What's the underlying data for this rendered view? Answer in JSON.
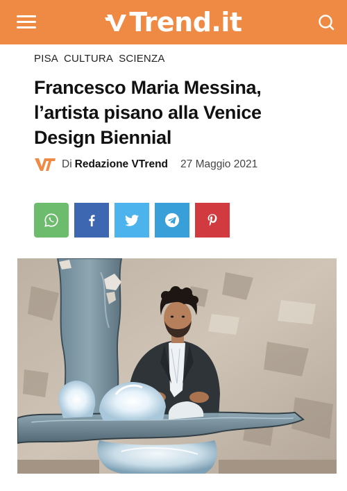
{
  "header": {
    "logo_text": "Trend.it",
    "menu_icon": "hamburger-menu-icon",
    "search_icon": "search-icon",
    "brand_color": "#ef8a45"
  },
  "categories": [
    "PISA",
    "CULTURA",
    "SCIENZA"
  ],
  "article": {
    "title": "Francesco Maria Messina, l’artista pisano alla Venice Design Biennial",
    "byline_prefix": "Di",
    "author": "Redazione VTrend",
    "date": "27 Maggio 2021"
  },
  "share_buttons": [
    {
      "icon": "whatsapp-icon",
      "color": "#6dbb6d"
    },
    {
      "icon": "facebook-icon",
      "color": "#3e67b1"
    },
    {
      "icon": "twitter-icon",
      "color": "#4db3ec"
    },
    {
      "icon": "telegram-icon",
      "color": "#399fd9"
    },
    {
      "icon": "pinterest-icon",
      "color": "#d13a3f"
    }
  ],
  "image": {
    "subject": "man-in-suit-seated-behind-glass-table-with-illuminated-crystals"
  }
}
